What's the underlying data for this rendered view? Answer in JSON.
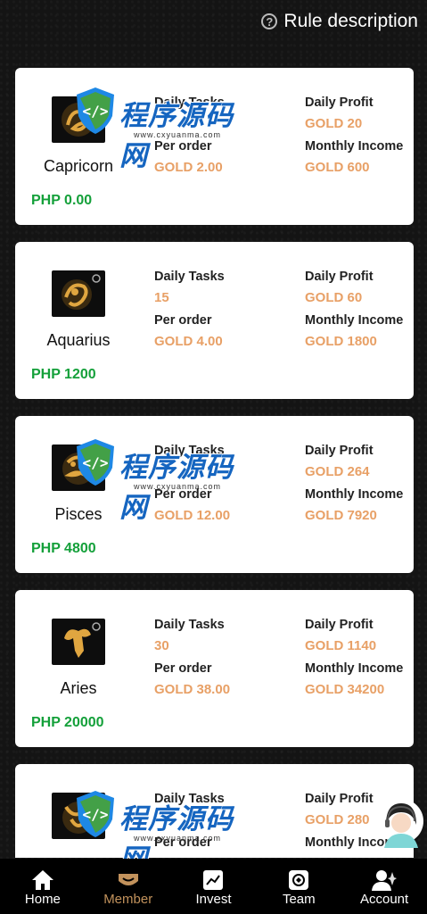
{
  "header": {
    "rule_label": "Rule description"
  },
  "labels": {
    "daily_tasks": "Daily Tasks",
    "per_order": "Per order",
    "daily_profit": "Daily Profit",
    "monthly_income": "Monthly Income"
  },
  "cards": [
    {
      "name": "Capricorn",
      "price": "PHP 0.00",
      "daily_tasks": "",
      "per_order": "GOLD 2.00",
      "daily_profit": "GOLD 20",
      "monthly_income": "GOLD 600",
      "icon": "capricorn-icon"
    },
    {
      "name": "Aquarius",
      "price": "PHP 1200",
      "daily_tasks": "15",
      "per_order": "GOLD 4.00",
      "daily_profit": "GOLD 60",
      "monthly_income": "GOLD 1800",
      "icon": "aquarius-icon"
    },
    {
      "name": "Pisces",
      "price": "PHP 4800",
      "daily_tasks": "",
      "per_order": "GOLD 12.00",
      "daily_profit": "GOLD 264",
      "monthly_income": "GOLD 7920",
      "icon": "pisces-icon"
    },
    {
      "name": "Aries",
      "price": "PHP 20000",
      "daily_tasks": "30",
      "per_order": "GOLD 38.00",
      "daily_profit": "GOLD 1140",
      "monthly_income": "GOLD 34200",
      "icon": "aries-icon"
    },
    {
      "daily_profit": "GOLD 280",
      "icon": "taurus-icon"
    }
  ],
  "watermark": {
    "text": "程序源码网",
    "url": "www.cxyuanma.com"
  },
  "tabs": [
    {
      "label": "Home",
      "icon": "home-icon"
    },
    {
      "label": "Member",
      "icon": "member-icon",
      "active": true
    },
    {
      "label": "Invest",
      "icon": "invest-icon"
    },
    {
      "label": "Team",
      "icon": "team-icon"
    },
    {
      "label": "Account",
      "icon": "account-icon"
    }
  ],
  "colors": {
    "accent": "#c2925c",
    "price": "#14a03a",
    "gold_value": "#e8a066"
  }
}
